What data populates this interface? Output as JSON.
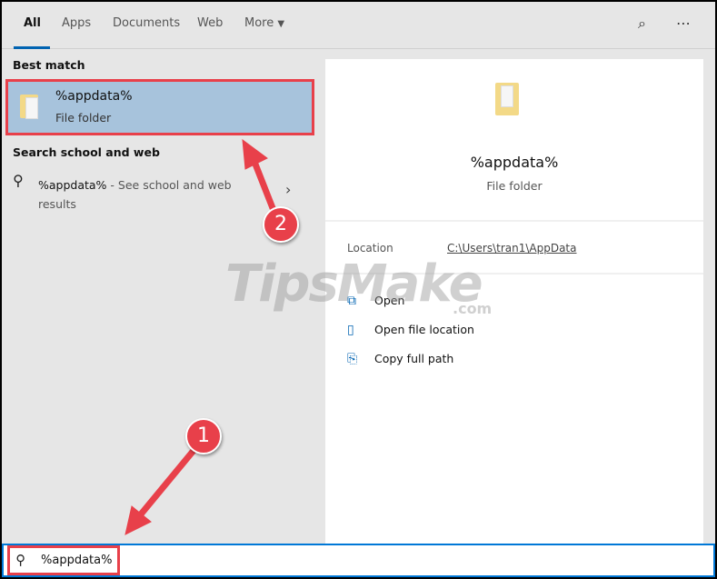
{
  "tabs": [
    {
      "label": "All",
      "active": true
    },
    {
      "label": "Apps"
    },
    {
      "label": "Documents"
    },
    {
      "label": "Web"
    },
    {
      "label": "More"
    }
  ],
  "toolbar": {
    "feedback_icon": "feedback-icon",
    "more_icon": "⋯"
  },
  "left": {
    "best_match_header": "Best match",
    "best_match": {
      "title": "%appdata%",
      "subtitle": "File folder"
    },
    "web_header": "Search school and web",
    "web_result": {
      "query": "%appdata%",
      "suffix": " - See school and web",
      "suffix2": "results"
    }
  },
  "preview": {
    "title": "%appdata%",
    "subtitle": "File folder",
    "location_label": "Location",
    "location_value": "C:\\Users\\tran1\\AppData",
    "actions": [
      {
        "label": "Open",
        "icon": "open-icon"
      },
      {
        "label": "Open file location",
        "icon": "file-location-icon"
      },
      {
        "label": "Copy full path",
        "icon": "copy-icon"
      }
    ]
  },
  "search": {
    "value": "%appdata%"
  },
  "annotations": {
    "step1": "1",
    "step2": "2",
    "color": "#e8404a"
  },
  "watermark": {
    "text": "TipsMake",
    ".com": ".com"
  }
}
